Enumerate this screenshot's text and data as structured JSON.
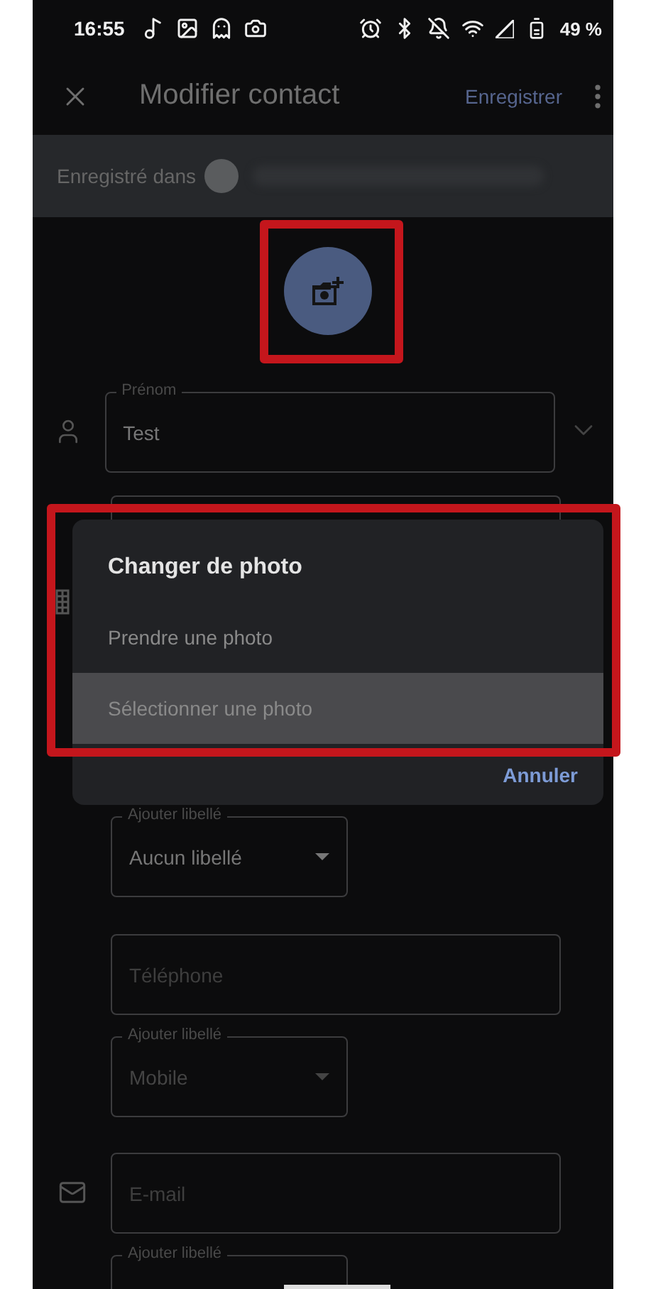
{
  "status_bar": {
    "time": "16:55",
    "battery": "49 %"
  },
  "app_bar": {
    "title": "Modifier contact",
    "action": "Enregistrer"
  },
  "saved_in": {
    "label": "Enregistré dans"
  },
  "first_name": {
    "label": "Prénom",
    "value": "Test"
  },
  "dialog": {
    "title": "Changer de photo",
    "options": [
      {
        "label": "Prendre une photo",
        "selected": false
      },
      {
        "label": "Sélectionner une photo",
        "selected": true
      }
    ],
    "cancel": "Annuler"
  },
  "label_select": {
    "label": "Ajouter libellé",
    "value": "Aucun libellé",
    "disabled": false
  },
  "phone": {
    "placeholder": "Téléphone"
  },
  "phone_label_select": {
    "label": "Ajouter libellé",
    "value": "Mobile",
    "disabled": true
  },
  "email": {
    "placeholder": "E-mail"
  },
  "email_label_select": {
    "label": "Ajouter libellé"
  }
}
